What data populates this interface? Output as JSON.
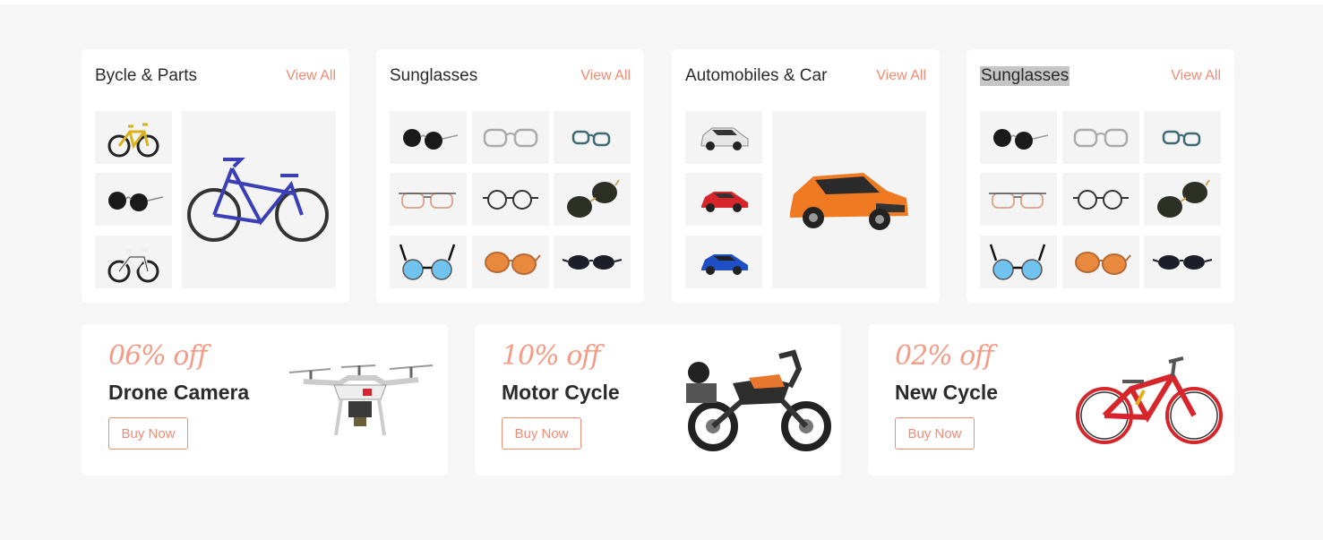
{
  "categories": [
    {
      "title": "Bycle & Parts",
      "view_all": "View All"
    },
    {
      "title": "Sunglasses",
      "view_all": "View All"
    },
    {
      "title": "Automobiles & Car",
      "view_all": "View All"
    },
    {
      "title": "Sunglasses",
      "view_all": "View All"
    }
  ],
  "promos": [
    {
      "discount": "06% off",
      "name": "Drone Camera",
      "button": "Buy Now"
    },
    {
      "discount": "10% off",
      "name": "Motor Cycle",
      "button": "Buy Now"
    },
    {
      "discount": "02% off",
      "name": "New Cycle",
      "button": "Buy Now"
    }
  ],
  "colors": {
    "accent": "#f28b73",
    "background": "#f6f6f6",
    "tile": "#f4f4f4"
  }
}
